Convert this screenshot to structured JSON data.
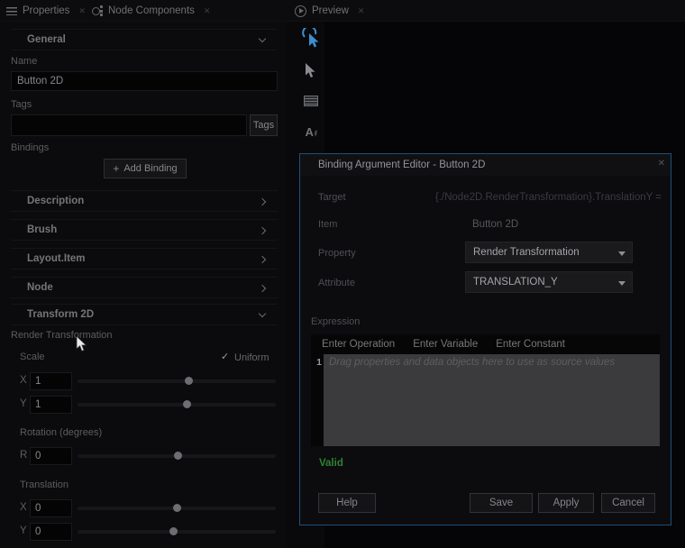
{
  "colors": {
    "accent_blue": "#3e8ed0",
    "dialog_border": "#1d5078",
    "valid_green": "#2f8232"
  },
  "tabs": {
    "properties": "Properties",
    "node_components": "Node Components",
    "preview": "Preview"
  },
  "panel": {
    "general_title": "General",
    "name_label": "Name",
    "name_value": "Button 2D",
    "tags_label": "Tags",
    "tags_value": "",
    "tags_button": "Tags",
    "bindings_label": "Bindings",
    "add_binding_button": "Add Binding",
    "section_description": "Description",
    "section_brush": "Brush",
    "section_layout_item": "Layout.Item",
    "section_node": "Node",
    "section_transform": "Transform 2D",
    "render_transformation_label": "Render Transformation",
    "scale_label": "Scale",
    "uniform_label": "Uniform",
    "uniform_checked": true,
    "scale_x_label": "X",
    "scale_x_value": "1",
    "scale_y_label": "Y",
    "scale_y_value": "1",
    "rotation_label": "Rotation (degrees)",
    "rotation_r_label": "R",
    "rotation_r_value": "0",
    "translation_label": "Translation",
    "translation_x_label": "X",
    "translation_x_value": "0",
    "translation_y_label": "Y",
    "translation_y_value": "0"
  },
  "preview": {
    "icons": [
      "interact-icon",
      "select-cursor-icon",
      "grid-icon",
      "text-tool-icon"
    ]
  },
  "dialog": {
    "title": "Binding Argument Editor - Button 2D",
    "target_label": "Target",
    "target_value": "{./Node2D.RenderTransformation}.TranslationY =",
    "item_label": "Item",
    "item_value": "Button 2D",
    "property_label": "Property",
    "property_value": "Render Transformation",
    "attribute_label": "Attribute",
    "attribute_value": "TRANSLATION_Y",
    "expression_label": "Expression",
    "expression_toolbar": [
      "Enter Operation",
      "Enter Variable",
      "Enter Constant"
    ],
    "line_number": "1",
    "expression_placeholder": "Drag properties and data objects here to use as source values",
    "status": "Valid",
    "buttons": {
      "help": "Help",
      "save": "Save",
      "apply": "Apply",
      "cancel": "Cancel"
    }
  }
}
